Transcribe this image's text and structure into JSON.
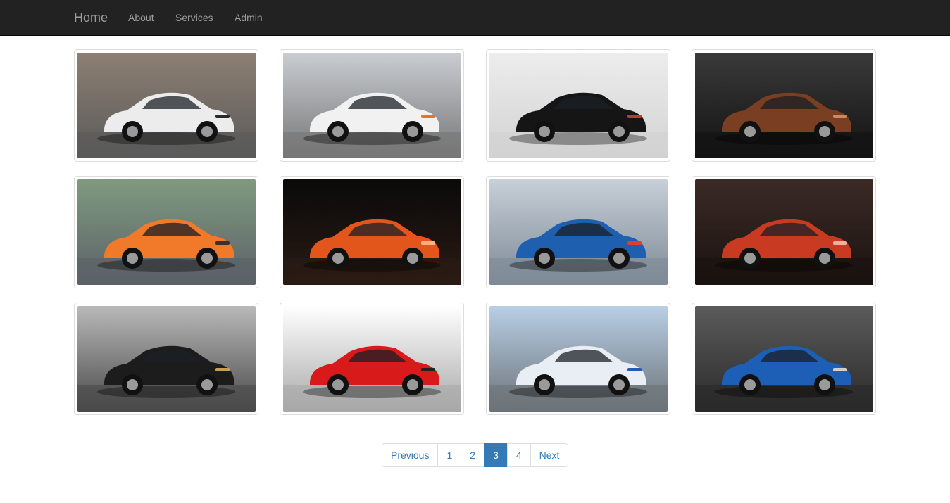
{
  "nav": {
    "brand": "Home",
    "links": [
      "About",
      "Services",
      "Admin"
    ]
  },
  "gallery": [
    {
      "subject": "white hatchback",
      "body": "#ececec",
      "bg1": "#8d7f72",
      "bg2": "#5a5a5a",
      "accent": "#2a2a2a"
    },
    {
      "subject": "safety car",
      "body": "#f1f1f1",
      "bg1": "#c9cdd2",
      "bg2": "#777777",
      "accent": "#e07a1f"
    },
    {
      "subject": "black sports car",
      "body": "#151515",
      "bg1": "#ededed",
      "bg2": "#d2d2d2",
      "accent": "#c23a2a"
    },
    {
      "subject": "bronze coupe",
      "body": "#7a3e22",
      "bg1": "#3a3a3a",
      "bg2": "#121212",
      "accent": "#c98b5e"
    },
    {
      "subject": "orange coupe",
      "body": "#f07a2a",
      "bg1": "#7f9a80",
      "bg2": "#5c6168",
      "accent": "#333333"
    },
    {
      "subject": "orange sports car",
      "body": "#e2561c",
      "bg1": "#0a0a0a",
      "bg2": "#2a1a14",
      "accent": "#ffb080"
    },
    {
      "subject": "hydrogen car chassis",
      "body": "#1f5fb0",
      "bg1": "#c7cfd8",
      "bg2": "#7e8a96",
      "accent": "#e53a2f"
    },
    {
      "subject": "red concept car",
      "body": "#c83a22",
      "bg1": "#3b2a26",
      "bg2": "#1a1210",
      "accent": "#e9b59a"
    },
    {
      "subject": "black sedan",
      "body": "#1c1c1c",
      "bg1": "#b9b9b9",
      "bg2": "#4a4a4a",
      "accent": "#c7a04a"
    },
    {
      "subject": "red supercar",
      "body": "#d81a1a",
      "bg1": "#ffffff",
      "bg2": "#a9a9a9",
      "accent": "#222222"
    },
    {
      "subject": "flying car",
      "body": "#e9eef5",
      "bg1": "#b8cfe6",
      "bg2": "#6d7378",
      "accent": "#1e5fae"
    },
    {
      "subject": "blue convertible",
      "body": "#1d5fb6",
      "bg1": "#5b5b5b",
      "bg2": "#2a2a2a",
      "accent": "#cfcfcf"
    }
  ],
  "pagination": {
    "previous": "Previous",
    "pages": [
      "1",
      "2",
      "3",
      "4"
    ],
    "active": "3",
    "next": "Next"
  },
  "colors": {
    "navbar": "#222222",
    "nav_text": "#9d9d9d",
    "link": "#337ab7",
    "active_page": "#337ab7"
  }
}
